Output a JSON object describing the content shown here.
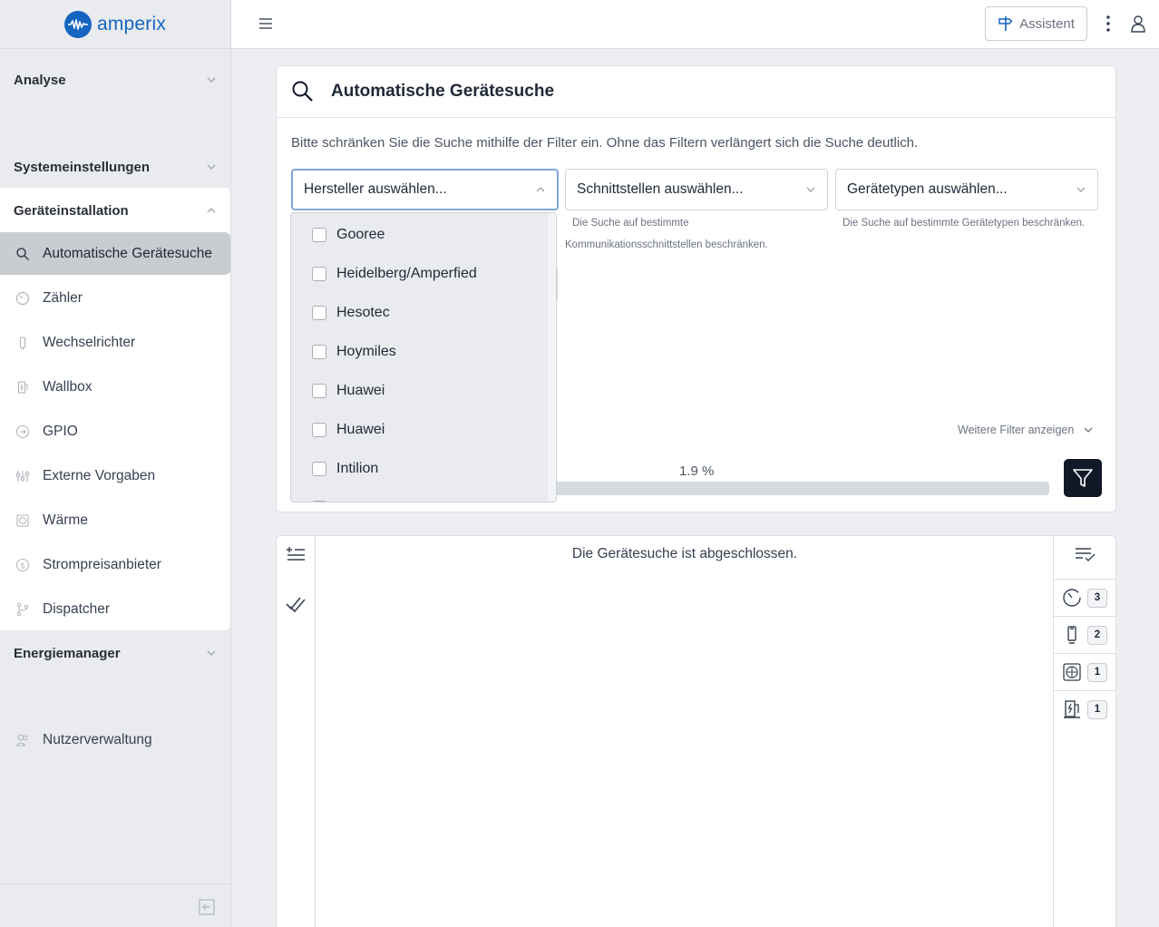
{
  "brand": {
    "name": "amperix",
    "color": "#1565c0"
  },
  "sidebar": {
    "sections": [
      {
        "label": "Analyse",
        "expanded": false
      },
      {
        "label": "Systemeinstellungen",
        "expanded": false
      },
      {
        "label": "Geräteinstallation",
        "expanded": true
      },
      {
        "label": "Energiemanager",
        "expanded": false
      }
    ],
    "items": [
      {
        "label": "Automatische Gerätesuche",
        "icon": "search-icon",
        "active": true
      },
      {
        "label": "Zähler",
        "icon": "meter-icon"
      },
      {
        "label": "Wechselrichter",
        "icon": "inverter-icon"
      },
      {
        "label": "Wallbox",
        "icon": "wallbox-icon"
      },
      {
        "label": "GPIO",
        "icon": "gpio-icon"
      },
      {
        "label": "Externe Vorgaben",
        "icon": "sliders-icon"
      },
      {
        "label": "Wärme",
        "icon": "heat-icon"
      },
      {
        "label": "Strompreisanbieter",
        "icon": "price-icon"
      },
      {
        "label": "Dispatcher",
        "icon": "dispatcher-icon"
      }
    ],
    "footer_item": {
      "label": "Nutzerverwaltung",
      "icon": "users-icon"
    }
  },
  "topbar": {
    "assistant_label": "Assistent"
  },
  "search_card": {
    "title": "Automatische Gerätesuche",
    "hint": "Bitte schränken Sie die Suche mithilfe der Filter ein. Ohne das Filtern verlängert sich die Suche deutlich.",
    "filters": {
      "manufacturer": {
        "placeholder": "Hersteller auswählen...",
        "open": true
      },
      "interfaces": {
        "placeholder": "Schnittstellen auswählen...",
        "help_1": "Die Suche auf bestimmte",
        "help_2": "Kommunikationsschnittstellen beschränken."
      },
      "device_types": {
        "placeholder": "Gerätetypen auswählen...",
        "help": "Die Suche auf bestimmte Gerätetypen beschränken."
      }
    },
    "more_filters": "Weitere Filter anzeigen",
    "progress": {
      "label": "1.9 %",
      "value": 1.9
    }
  },
  "manufacturer_options": [
    "Gooree",
    "Heidelberg/Amperfied",
    "Hesotec",
    "Hoymiles",
    "Huawei",
    "Huawei",
    "Intilion"
  ],
  "results": {
    "message": "Die Gerätesuche ist abgeschlossen.",
    "categories": [
      {
        "icon": "meter-icon",
        "count": "3"
      },
      {
        "icon": "inverter-icon",
        "count": "2"
      },
      {
        "icon": "heat-icon",
        "count": "1"
      },
      {
        "icon": "wallbox-icon",
        "count": "1"
      }
    ]
  }
}
